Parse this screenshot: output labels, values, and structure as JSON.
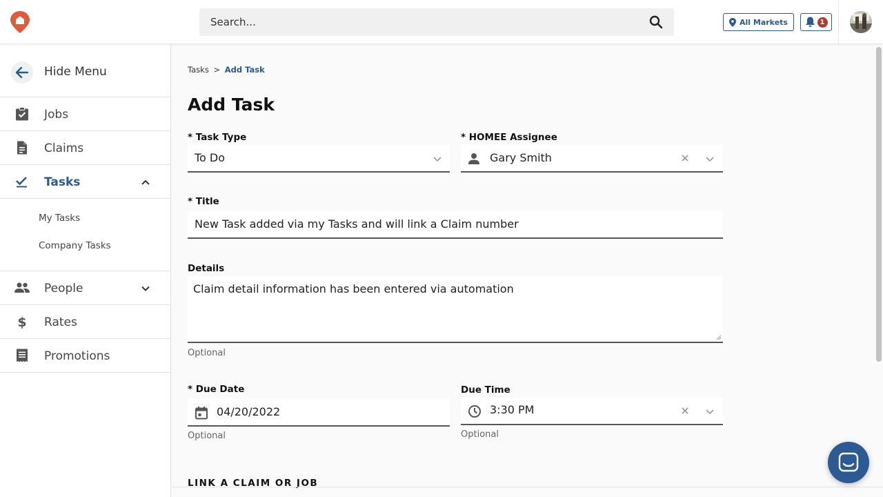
{
  "header": {
    "search_placeholder": "Search...",
    "markets_label": "All Markets",
    "notification_count": "1",
    "brand_color": "#e05a3c",
    "accent_color": "#2b5a8f"
  },
  "sidebar": {
    "hide_menu_label": "Hide Menu",
    "items": [
      {
        "label": "Jobs",
        "icon": "clipboard-check-icon"
      },
      {
        "label": "Claims",
        "icon": "document-icon"
      },
      {
        "label": "Tasks",
        "icon": "checkmark-icon",
        "active": true,
        "expanded": true
      },
      {
        "label": "People",
        "icon": "people-icon",
        "expanded": false
      },
      {
        "label": "Rates",
        "icon": "dollar-icon"
      },
      {
        "label": "Promotions",
        "icon": "receipt-icon"
      }
    ],
    "tasks_subitems": [
      "My Tasks",
      "Company Tasks"
    ]
  },
  "main": {
    "breadcrumb_root": "Tasks",
    "breadcrumb_sep": ">",
    "breadcrumb_current": "Add Task",
    "page_title": "Add Task",
    "task_type": {
      "label": "* Task Type",
      "value": "To Do"
    },
    "assignee": {
      "label": "* HOMEE Assignee",
      "value": "Gary Smith"
    },
    "title": {
      "label": "* Title",
      "value": "New Task added via my Tasks and will link a Claim number"
    },
    "details": {
      "label": "Details",
      "value": "Claim detail information has been entered via automation",
      "hint": "Optional"
    },
    "due_date": {
      "label": "* Due Date",
      "value": "04/20/2022",
      "hint": "Optional"
    },
    "due_time": {
      "label": "Due Time",
      "value": "3:30 PM",
      "hint": "Optional"
    },
    "link_section_title": "LINK A CLAIM OR JOB"
  }
}
